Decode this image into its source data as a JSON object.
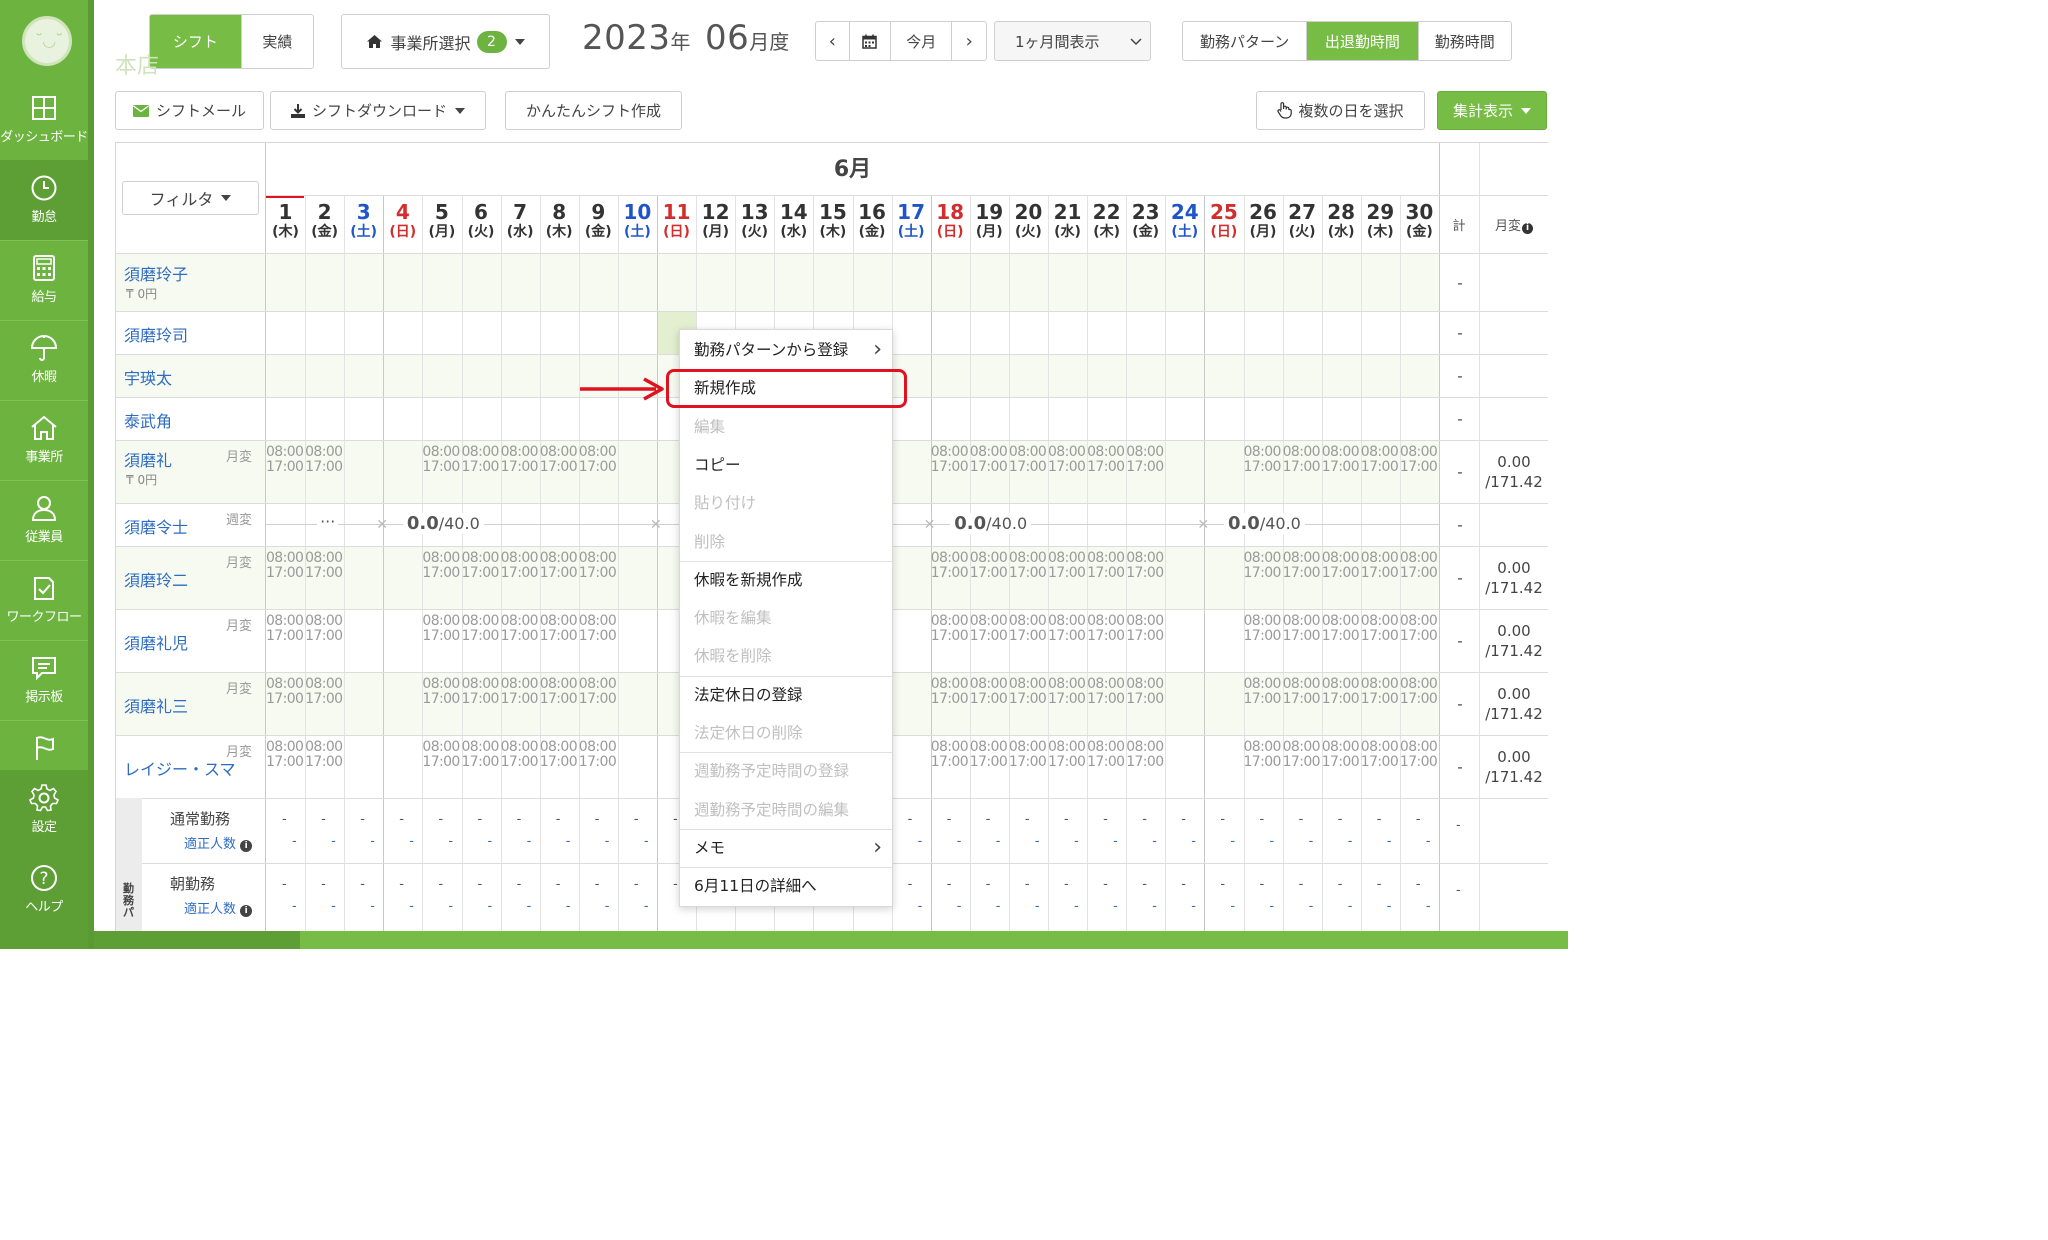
{
  "sidebar": {
    "items": [
      {
        "label": "ダッシュボード",
        "icon": "dashboard-icon"
      },
      {
        "label": "勤怠",
        "icon": "clock-icon"
      },
      {
        "label": "給与",
        "icon": "calculator-icon"
      },
      {
        "label": "休暇",
        "icon": "umbrella-icon"
      },
      {
        "label": "事業所",
        "icon": "home-icon"
      },
      {
        "label": "従業員",
        "icon": "person-icon"
      },
      {
        "label": "ワークフロー",
        "icon": "workflow-icon"
      },
      {
        "label": "掲示板",
        "icon": "message-icon"
      },
      {
        "label": "",
        "icon": "flag-icon"
      },
      {
        "label": "設定",
        "icon": "gear-icon"
      },
      {
        "label": "ヘルプ",
        "icon": "help-icon"
      }
    ],
    "active": "勤怠"
  },
  "header": {
    "tabs": [
      "シフト",
      "実績"
    ],
    "office_select_label": "事業所選択",
    "office_select_count": "2",
    "location_title": "本店",
    "year": "2023",
    "year_unit": "年",
    "month": "06",
    "month_unit": "月度",
    "today_label": "今月",
    "range_label": "1ヶ月間表示",
    "view_tabs": [
      "勤務パターン",
      "出退勤時間",
      "勤務時間"
    ]
  },
  "toolbar": {
    "shift_mail": "シフトメール",
    "shift_download": "シフトダウンロード",
    "easy_shift": "かんたんシフト作成",
    "multi_select": "複数の日を選択",
    "summary": "集計表示"
  },
  "grid": {
    "filter_label": "フィルタ",
    "month_header": "6月",
    "total_header": "計",
    "change_header": "月変",
    "days": [
      {
        "d": "1",
        "w": "(木)",
        "t": ""
      },
      {
        "d": "2",
        "w": "(金)",
        "t": ""
      },
      {
        "d": "3",
        "w": "(土)",
        "t": "sat"
      },
      {
        "d": "4",
        "w": "(日)",
        "t": "sun"
      },
      {
        "d": "5",
        "w": "(月)",
        "t": ""
      },
      {
        "d": "6",
        "w": "(火)",
        "t": ""
      },
      {
        "d": "7",
        "w": "(水)",
        "t": ""
      },
      {
        "d": "8",
        "w": "(木)",
        "t": ""
      },
      {
        "d": "9",
        "w": "(金)",
        "t": ""
      },
      {
        "d": "10",
        "w": "(土)",
        "t": "sat"
      },
      {
        "d": "11",
        "w": "(日)",
        "t": "sun"
      },
      {
        "d": "12",
        "w": "(月)",
        "t": ""
      },
      {
        "d": "13",
        "w": "(火)",
        "t": ""
      },
      {
        "d": "14",
        "w": "(水)",
        "t": ""
      },
      {
        "d": "15",
        "w": "(木)",
        "t": ""
      },
      {
        "d": "16",
        "w": "(金)",
        "t": ""
      },
      {
        "d": "17",
        "w": "(土)",
        "t": "sat"
      },
      {
        "d": "18",
        "w": "(日)",
        "t": "sun"
      },
      {
        "d": "19",
        "w": "(月)",
        "t": ""
      },
      {
        "d": "20",
        "w": "(火)",
        "t": ""
      },
      {
        "d": "21",
        "w": "(水)",
        "t": ""
      },
      {
        "d": "22",
        "w": "(木)",
        "t": ""
      },
      {
        "d": "23",
        "w": "(金)",
        "t": ""
      },
      {
        "d": "24",
        "w": "(土)",
        "t": "sat"
      },
      {
        "d": "25",
        "w": "(日)",
        "t": "sun"
      },
      {
        "d": "26",
        "w": "(月)",
        "t": ""
      },
      {
        "d": "27",
        "w": "(火)",
        "t": ""
      },
      {
        "d": "28",
        "w": "(水)",
        "t": ""
      },
      {
        "d": "29",
        "w": "(木)",
        "t": ""
      },
      {
        "d": "30",
        "w": "(金)",
        "t": ""
      }
    ],
    "shift_start": "08:00",
    "shift_end": "17:00",
    "employees": [
      {
        "name": "須磨玲子",
        "yen": "0円",
        "tag": "",
        "total": "-",
        "monthly": ""
      },
      {
        "name": "須磨玲司",
        "yen": "",
        "tag": "",
        "total": "-",
        "monthly": ""
      },
      {
        "name": "宇瑛太",
        "yen": "",
        "tag": "",
        "total": "-",
        "monthly": ""
      },
      {
        "name": "泰武角",
        "yen": "",
        "tag": "",
        "total": "-",
        "monthly": ""
      },
      {
        "name": "須磨礼",
        "yen": "0円",
        "tag": "月変",
        "total": "-",
        "monthly": "0.00",
        "monthly2": "/171.42"
      },
      {
        "name": "須磨令士",
        "yen": "",
        "tag": "週変",
        "total": "-",
        "monthly": ""
      },
      {
        "name": "須磨玲二",
        "yen": "",
        "tag": "月変",
        "total": "-",
        "monthly": "0.00",
        "monthly2": "/171.42"
      },
      {
        "name": "須磨礼児",
        "yen": "",
        "tag": "月変",
        "total": "-",
        "monthly": "0.00",
        "monthly2": "/171.42"
      },
      {
        "name": "須磨礼三",
        "yen": "",
        "tag": "月変",
        "total": "-",
        "monthly": "0.00",
        "monthly2": "/171.42"
      },
      {
        "name": "レイジー・スマ",
        "yen": "",
        "tag": "月変",
        "total": "-",
        "monthly": "0.00",
        "monthly2": "/171.42"
      }
    ],
    "week_value": "0.0",
    "week_target": "/40.0",
    "week_dots": "···",
    "summary_rows": [
      {
        "title": "通常勤務",
        "sub": "適正人数"
      },
      {
        "title": "朝勤務",
        "sub": "適正人数"
      }
    ],
    "summary_vertical_label": "勤務パ"
  },
  "context_menu": {
    "items": [
      {
        "label": "勤務パターンから登録",
        "disabled": false,
        "submenu": true
      },
      {
        "label": "新規作成",
        "disabled": false,
        "submenu": false
      },
      {
        "label": "編集",
        "disabled": true,
        "submenu": false
      },
      {
        "label": "コピー",
        "disabled": false,
        "submenu": false
      },
      {
        "label": "貼り付け",
        "disabled": true,
        "submenu": false
      },
      {
        "label": "削除",
        "disabled": true,
        "submenu": false
      },
      {
        "label": "休暇を新規作成",
        "disabled": false,
        "submenu": false
      },
      {
        "label": "休暇を編集",
        "disabled": true,
        "submenu": false
      },
      {
        "label": "休暇を削除",
        "disabled": true,
        "submenu": false
      },
      {
        "label": "法定休日の登録",
        "disabled": false,
        "submenu": false
      },
      {
        "label": "法定休日の削除",
        "disabled": true,
        "submenu": false
      },
      {
        "label": "週勤務予定時間の登録",
        "disabled": true,
        "submenu": false
      },
      {
        "label": "週勤務予定時間の編集",
        "disabled": true,
        "submenu": false
      },
      {
        "label": "メモ",
        "disabled": false,
        "submenu": true
      },
      {
        "label": "6月11日の詳細へ",
        "disabled": false,
        "submenu": false
      }
    ],
    "arrow_glyph": "›"
  },
  "colors": {
    "brand": "#6db33f",
    "saturday": "#1f55c8",
    "sunday": "#d32e2e",
    "highlight": "#e0121f",
    "link": "#2e6cc1"
  }
}
